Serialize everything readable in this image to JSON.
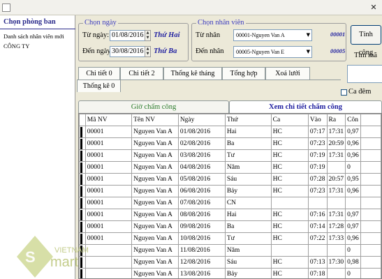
{
  "window": {
    "close_icon": "close-icon"
  },
  "left_panel": {
    "title": "Chọn phòng ban",
    "items": [
      "Danh sách nhân viên mới",
      "CÔNG TY"
    ]
  },
  "date_group": {
    "legend": "Chọn ngày",
    "from_label": "Từ ngày:",
    "from_value": "01/08/2016",
    "from_weekday": "Thứ Hai",
    "to_label": "Đến ngày:",
    "to_value": "30/08/2016",
    "to_weekday": "Thứ Ba"
  },
  "employee_group": {
    "legend": "Chọn nhân viên",
    "from_label": "Từ nhân",
    "from_value": "00001-Nguyen Van A",
    "from_code": "00001",
    "to_label": "Đến nhân",
    "to_value": "00005-Nguyen Van E",
    "to_code": "00005"
  },
  "actions": {
    "calculate_label": "Tính công",
    "search_label": "Tìm mã",
    "night_shift_label": "Ca đêm"
  },
  "tabs": [
    "Chi tiết 0",
    "Chi tiết 2",
    "Thống kê tháng",
    "Tổng hợp",
    "Xoá lưới",
    "Thống kê 0"
  ],
  "subtabs": [
    "Giờ chấm công",
    "Xem chi tiết chấm công"
  ],
  "table": {
    "columns": [
      "Mã NV",
      "Tên NV",
      "Ngày",
      "Thứ",
      "Ca",
      "Vào",
      "Ra",
      "Côn"
    ],
    "rows": [
      [
        "00001",
        "Nguyen Van A",
        "01/08/2016",
        "Hai",
        "HC",
        "07:17",
        "17:31",
        "0,97"
      ],
      [
        "00001",
        "Nguyen Van A",
        "02/08/2016",
        "Ba",
        "HC",
        "07:23",
        "20:59",
        "0,96"
      ],
      [
        "00001",
        "Nguyen Van A",
        "03/08/2016",
        "Tư",
        "HC",
        "07:19",
        "17:31",
        "0,96"
      ],
      [
        "00001",
        "Nguyen Van A",
        "04/08/2016",
        "Năm",
        "HC",
        "07:19",
        "",
        "0"
      ],
      [
        "00001",
        "Nguyen Van A",
        "05/08/2016",
        "Sáu",
        "HC",
        "07:28",
        "20:57",
        "0,95"
      ],
      [
        "00001",
        "Nguyen Van A",
        "06/08/2016",
        "Bảy",
        "HC",
        "07:23",
        "17:31",
        "0,96"
      ],
      [
        "00001",
        "Nguyen Van A",
        "07/08/2016",
        "CN",
        "",
        "",
        "",
        ""
      ],
      [
        "00001",
        "Nguyen Van A",
        "08/08/2016",
        "Hai",
        "HC",
        "07:16",
        "17:31",
        "0,97"
      ],
      [
        "00001",
        "Nguyen Van A",
        "09/08/2016",
        "Ba",
        "HC",
        "07:14",
        "17:28",
        "0,97"
      ],
      [
        "00001",
        "Nguyen Van A",
        "10/08/2016",
        "Tư",
        "HC",
        "07:22",
        "17:33",
        "0,96"
      ],
      [
        "",
        "Nguyen Van A",
        "11/08/2016",
        "Năm",
        "",
        "",
        "",
        "0"
      ],
      [
        "",
        "Nguyen Van A",
        "12/08/2016",
        "Sáu",
        "HC",
        "07:13",
        "17:30",
        "0,98"
      ],
      [
        "",
        "Nguyen Van A",
        "13/08/2016",
        "Bảy",
        "HC",
        "07:18",
        "",
        "0"
      ]
    ]
  },
  "watermark": {
    "brand_top": "VIETNAM",
    "brand_bottom": "mart"
  }
}
